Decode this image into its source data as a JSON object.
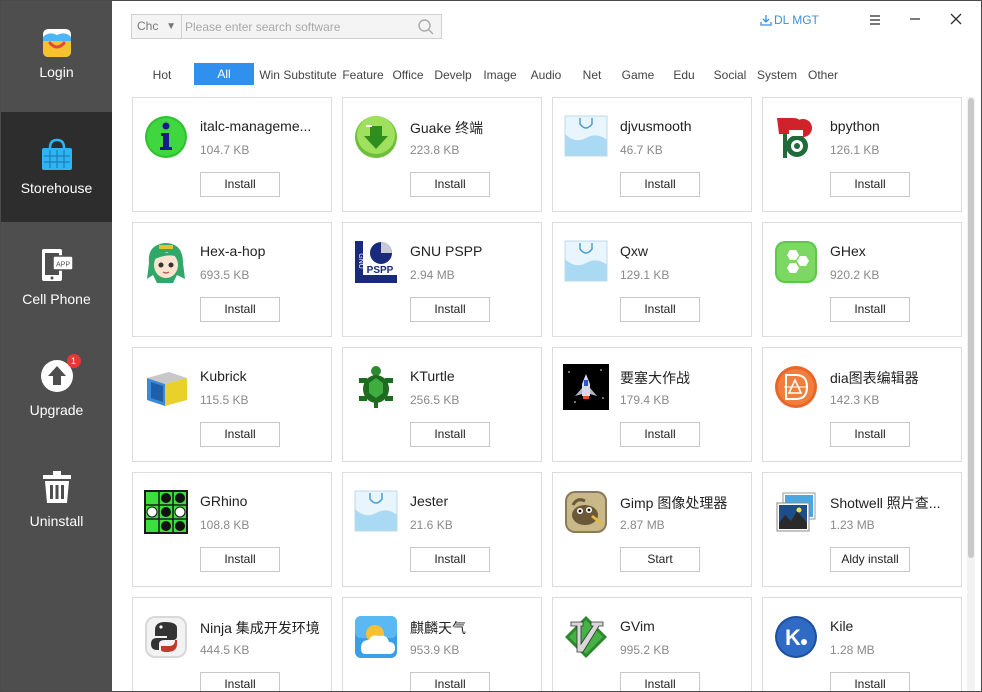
{
  "sidebar": {
    "items": [
      {
        "label": "Login",
        "icon": "login-icon"
      },
      {
        "label": "Storehouse",
        "icon": "shopping-bag-icon"
      },
      {
        "label": "Cell Phone",
        "icon": "cell-phone-icon",
        "icon_text": "APP"
      },
      {
        "label": "Upgrade",
        "icon": "upgrade-icon",
        "badge": "1"
      },
      {
        "label": "Uninstall",
        "icon": "trash-icon"
      }
    ],
    "active": "Storehouse"
  },
  "search": {
    "select_value": "Chc",
    "placeholder": "Please enter search software",
    "value": ""
  },
  "toolbar": {
    "dl_mgt_label": "DL MGT",
    "accent_color": "#3d8ee0"
  },
  "categories": [
    "Hot",
    "All",
    "Win Substitute",
    "Feature",
    "Office",
    "Develp",
    "Image",
    "Audio",
    "Net",
    "Game",
    "Edu",
    "Social",
    "System",
    "Other"
  ],
  "active_category": "All",
  "apps": [
    {
      "name": "italc-management-console",
      "display": "italc-manageme...",
      "size": "104.7 KB",
      "action": "Install",
      "icon": "info-icon"
    },
    {
      "name": "Guake 终端",
      "display": "Guake 终端",
      "size": "223.8 KB",
      "action": "Install",
      "icon": "guake-icon"
    },
    {
      "name": "djvusmooth",
      "display": "djvusmooth",
      "size": "46.7 KB",
      "action": "Install",
      "icon": "shopping-bag-icon"
    },
    {
      "name": "bpython",
      "display": "bpython",
      "size": "126.1 KB",
      "action": "Install",
      "icon": "bpython-icon"
    },
    {
      "name": "Hex-a-hop",
      "display": "Hex-a-hop",
      "size": "693.5 KB",
      "action": "Install",
      "icon": "anime-girl-icon"
    },
    {
      "name": "GNU PSPP",
      "display": "GNU PSPP",
      "size": "2.94 MB",
      "action": "Install",
      "icon": "pspp-icon",
      "icon_text": "PSPP",
      "icon_text2": "GNU"
    },
    {
      "name": "Qxw",
      "display": "Qxw",
      "size": "129.1 KB",
      "action": "Install",
      "icon": "shopping-bag-icon"
    },
    {
      "name": "GHex",
      "display": "GHex",
      "size": "920.2 KB",
      "action": "Install",
      "icon": "ghex-icon"
    },
    {
      "name": "Kubrick",
      "display": "Kubrick",
      "size": "115.5 KB",
      "action": "Install",
      "icon": "cube-icon"
    },
    {
      "name": "KTurtle",
      "display": "KTurtle",
      "size": "256.5 KB",
      "action": "Install",
      "icon": "turtle-icon"
    },
    {
      "name": "要塞大作战",
      "display": "要塞大作战",
      "size": "179.4 KB",
      "action": "Install",
      "icon": "spaceship-icon"
    },
    {
      "name": "dia图表编辑器",
      "display": "dia图表编辑器",
      "size": "142.3 KB",
      "action": "Install",
      "icon": "dia-icon"
    },
    {
      "name": "GRhino",
      "display": "GRhino",
      "size": "108.8 KB",
      "action": "Install",
      "icon": "othello-board-icon"
    },
    {
      "name": "Jester",
      "display": "Jester",
      "size": "21.6 KB",
      "action": "Install",
      "icon": "shopping-bag-icon"
    },
    {
      "name": "Gimp 图像处理器",
      "display": "Gimp 图像处理器",
      "size": "2.87 MB",
      "action": "Start",
      "icon": "gimp-icon"
    },
    {
      "name": "Shotwell 照片查看器",
      "display": "Shotwell 照片查...",
      "size": "1.23 MB",
      "action": "Aldy install",
      "icon": "photos-icon"
    },
    {
      "name": "Ninja 集成开发环境",
      "display": "Ninja 集成开发环境",
      "size": "444.5 KB",
      "action": "Install",
      "icon": "python-icon"
    },
    {
      "name": "麒麟天气",
      "display": "麒麟天气",
      "size": "953.9 KB",
      "action": "Install",
      "icon": "weather-icon"
    },
    {
      "name": "GVim",
      "display": "GVim",
      "size": "995.2 KB",
      "action": "Install",
      "icon": "vim-icon"
    },
    {
      "name": "Kile",
      "display": "Kile",
      "size": "1.28 MB",
      "action": "Install",
      "icon": "kile-icon",
      "icon_text": "K"
    }
  ]
}
